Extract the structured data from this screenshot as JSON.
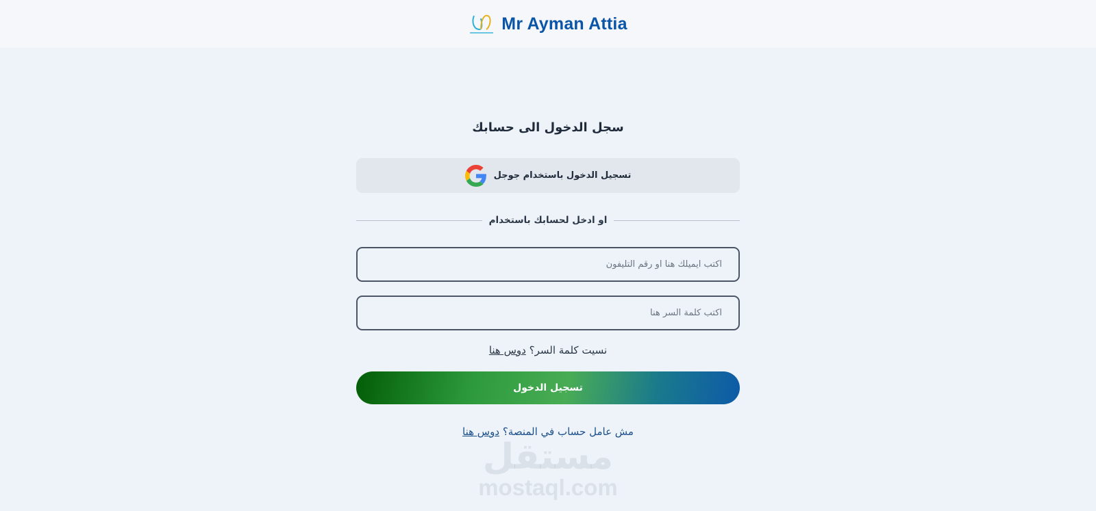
{
  "header": {
    "brand_name": "Mr Ayman Attia",
    "logo_icon": "teacher-logo-icon"
  },
  "login": {
    "title": "سجل الدخول الى حسابك",
    "google_button_label": "تسجيل الدخول باستخدام جوجل",
    "google_icon": "google-icon",
    "divider_text": "او ادخل لحسابك باستخدام",
    "email_placeholder": "اكتب ايميلك هنا او رقم التليفون",
    "password_placeholder": "اكتب كلمة السر هنا",
    "forgot_text": "نسيت كلمة السر؟",
    "forgot_link": "دوس هنا",
    "submit_label": "تسجيل الدخول",
    "signup_text": "مش عامل حساب في المنصة؟",
    "signup_link": "دوس هنا"
  },
  "watermark": {
    "arabic": "مستقل",
    "latin": "mostaql.com"
  },
  "colors": {
    "brand": "#0b55a6",
    "background": "#eef3f9",
    "gradient_start": "#035d07",
    "gradient_end": "#0d5aa8"
  }
}
